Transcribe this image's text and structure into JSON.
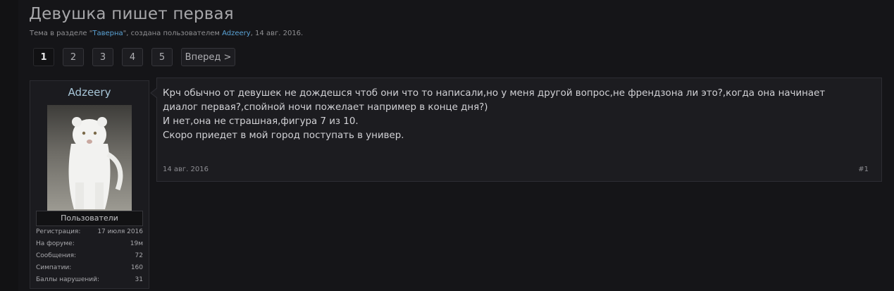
{
  "thread": {
    "title": "Девушка пишет первая",
    "meta_prefix": "Тема в разделе \"",
    "section": "Таверна",
    "meta_middle": "\", создана пользователем ",
    "author": "Adzeery",
    "meta_date": ", 14 авг. 2016."
  },
  "pager": {
    "pages": [
      "1",
      "2",
      "3",
      "4",
      "5"
    ],
    "current": "1",
    "next_label": "Вперед >"
  },
  "user": {
    "name": "Adzeery",
    "avatar_icon": "white-lion-avatar",
    "role": "Пользователи",
    "stats": [
      {
        "label": "Регистрация:",
        "value": "17 июля 2016"
      },
      {
        "label": "На форуме:",
        "value": "19м"
      },
      {
        "label": "Сообщения:",
        "value": "72"
      },
      {
        "label": "Симпатии:",
        "value": "160"
      },
      {
        "label": "Баллы нарушений:",
        "value": "31"
      }
    ]
  },
  "post": {
    "lines": [
      "Крч обычно от девушек не дождешся чтоб они что то написали,но у меня другой вопрос,не френдзона ли это?,когда она начинает",
      "диалог первая?,спойной ночи пожелает например в конце дня?)",
      "И нет,она не страшная,фигура 7 из 10.",
      "Скоро приедет в мой город поступать в универ."
    ],
    "date": "14 авг. 2016",
    "number": "#1"
  },
  "colors": {
    "background": "#151518",
    "link": "#5aa3d6",
    "username": "#a8c6d8"
  }
}
